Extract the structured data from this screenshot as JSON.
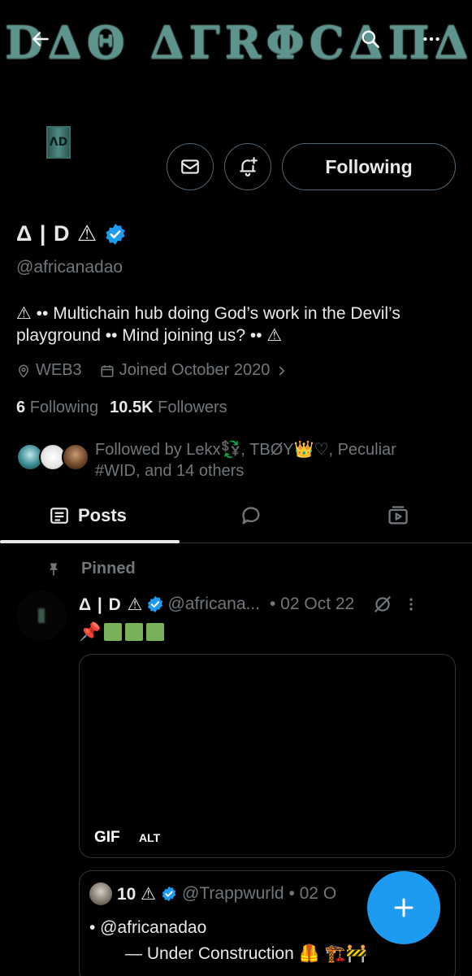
{
  "banner": {
    "text": "DΔΘ ΔΓRΦCΔПΔ"
  },
  "profile": {
    "display_name": "Δ | D ⚠",
    "handle": "@africanadao",
    "bio": "⚠ •• Multichain hub doing God’s work in the Devil’s playground •• Mind joining us? •• ⚠",
    "location": "WEB3",
    "joined": "Joined October 2020",
    "following_count": "6",
    "following_label": "Following",
    "followers_count": "10.5K",
    "followers_label": "Followers",
    "followed_by": "Followed by Lekx💱, TBØY👑♡, Peculiar #WID, and 14 others",
    "follow_button_label": "Following"
  },
  "tabs": [
    {
      "label": "Posts",
      "icon": "posts-icon",
      "selected": true
    },
    {
      "label": "",
      "icon": "replies-icon",
      "selected": false
    },
    {
      "label": "",
      "icon": "media-icon",
      "selected": false
    }
  ],
  "pinned_post": {
    "pinned_label": "Pinned",
    "author_name": "Δ | D ⚠",
    "author_handle": "@africana...",
    "date": "• 02 Oct 22",
    "text_prefix": "📌",
    "gif_label": "GIF",
    "alt_label": "ALT",
    "quoted": {
      "author_name": "10 ⚠",
      "author_handle": "@Trappwurld • 02 O",
      "line1": "• @africanadao",
      "line2": "— Under Construction 🦺 🏗️🚧"
    }
  },
  "colors": {
    "background": "#000000",
    "accent": "#1d9bf0",
    "text_primary": "#e7e9ea",
    "text_secondary": "#71767b",
    "border": "#2f3336"
  }
}
